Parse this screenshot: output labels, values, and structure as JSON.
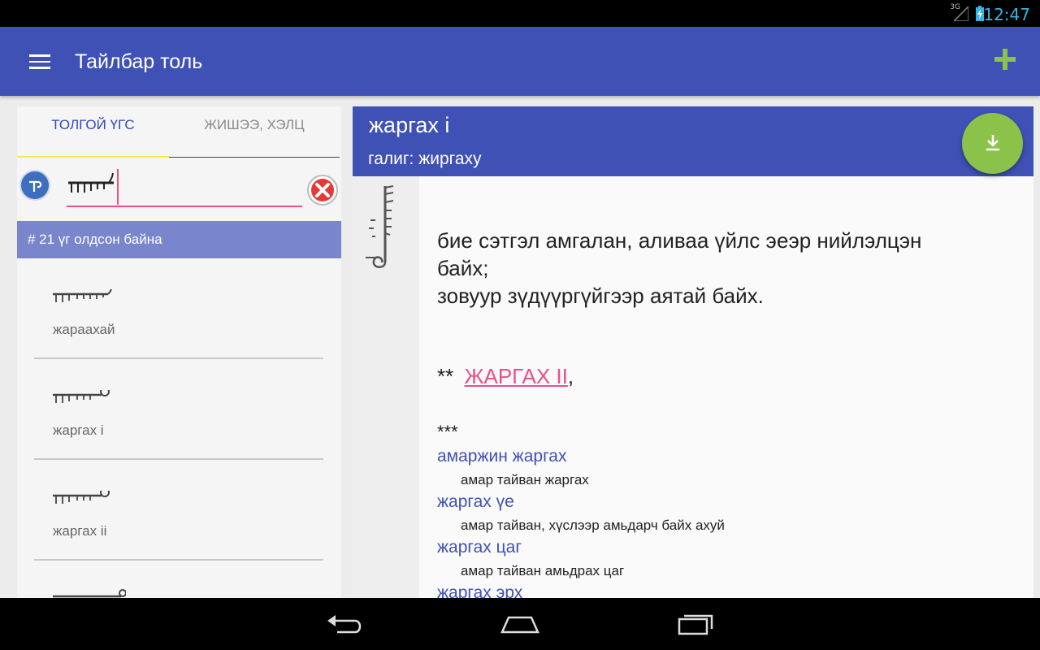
{
  "status": {
    "network": "3G",
    "time": "12:47"
  },
  "appbar": {
    "title": "Тайлбар толь",
    "menu_icon": "hamburger-menu-icon",
    "add_icon": "plus-icon"
  },
  "tabs": [
    {
      "label": "ТОЛГОЙ ҮГС"
    },
    {
      "label": "ЖИШЭЭ, ХЭЛЦ"
    }
  ],
  "search": {
    "input_value_script": "mongolian-script",
    "clear_icon": "clear-x-icon",
    "keyboard_icon": "mongolian-keyboard-icon"
  },
  "results": {
    "count_label": "# 21 үг олдсон байна"
  },
  "list": [
    {
      "cyrillic": "жараахай"
    },
    {
      "cyrillic": "жаргах i"
    },
    {
      "cyrillic": "жаргах ii"
    }
  ],
  "entry": {
    "headword": "жаргах i",
    "translit": "галиг:  жиргаху",
    "definition_line1": "бие сэтгэл амгалан, аливаа үйлс эеэр нийлэлцэн",
    "definition_line2": "байх;",
    "definition_line3": "зовуур зүдүүргүйгээр аятай байх.",
    "ref_prefix": "**",
    "ref_link": "ЖАРГАХ II",
    "ref_suffix": ",",
    "stars": "***",
    "phrases": [
      {
        "phrase": "амаржин жаргах",
        "gloss": "амар тайван жаргах"
      },
      {
        "phrase": "жаргах үе",
        "gloss": "амар тайван, хүслээр амьдарч байх ахуй"
      },
      {
        "phrase": "жаргах цаг",
        "gloss": "амар тайван амьдрах цаг"
      },
      {
        "phrase": "жаргах эрх",
        "gloss": ""
      }
    ]
  },
  "colors": {
    "primary": "#3f51b5",
    "accent": "#e94f8a",
    "fab": "#8bc34a",
    "count_bar": "#7986cb"
  }
}
